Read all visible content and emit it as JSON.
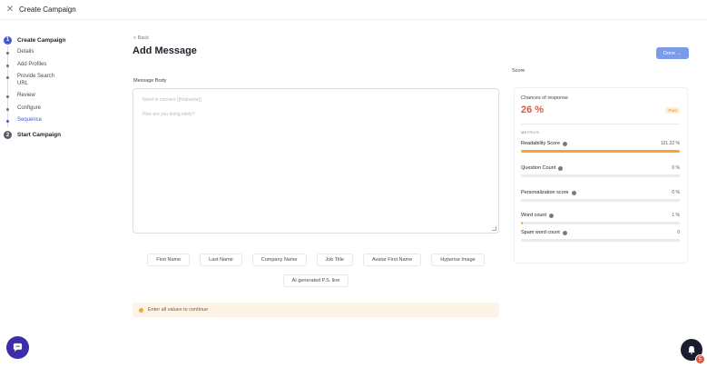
{
  "topbar": {
    "close_icon": "close-icon",
    "title": "Create Campaign"
  },
  "stepper": {
    "step1": {
      "number": "1",
      "label": "Create Campaign"
    },
    "substeps": [
      {
        "label": "Details"
      },
      {
        "label": "Add Profiles"
      },
      {
        "label": "Provide Search URL"
      },
      {
        "label": "Review"
      },
      {
        "label": "Configure"
      },
      {
        "label": "Sequence",
        "active": true
      }
    ],
    "step2": {
      "number": "2",
      "label": "Start Campaign"
    }
  },
  "main": {
    "back_label": "< Back",
    "title": "Add Message",
    "body_label": "Message Body",
    "placeholder_line1": "Need to connect {{firstname}}",
    "placeholder_line2": "How are you doing lately?",
    "chips_row1": [
      "First Name",
      "Last Name",
      "Company Name",
      "Job Title",
      "Avatar First Name",
      "Hyperise Image"
    ],
    "chips_row2": [
      "AI generated P.S. line"
    ],
    "notice": "Enter all values to continue"
  },
  "right": {
    "done_label": "Done →",
    "score_label": "Score",
    "chances_label": "Chances of response",
    "chances_value": "26 %",
    "chances_badge": "Poor",
    "metrics_heading": "METRICS",
    "metrics": [
      {
        "name": "Readability Score",
        "value": "121.22 %",
        "fill": 1.0
      },
      {
        "name": "Question Count",
        "value": "0 %",
        "fill": 0
      },
      {
        "name": "Personalization score",
        "value": "0 %",
        "fill": 0
      },
      {
        "name": "Word count",
        "value": "1 %",
        "fill": 0.01
      },
      {
        "name": "Spam word count",
        "value": "0",
        "fill": 0
      }
    ]
  },
  "widgets": {
    "chat_icon": "chat-bubble-icon",
    "notification_icon": "bell-icon",
    "notification_count": "5"
  },
  "colors": {
    "accent": "#3d5bd9",
    "warning": "#f3a829",
    "danger": "#e8523f",
    "done_button": "#7a9be8"
  }
}
